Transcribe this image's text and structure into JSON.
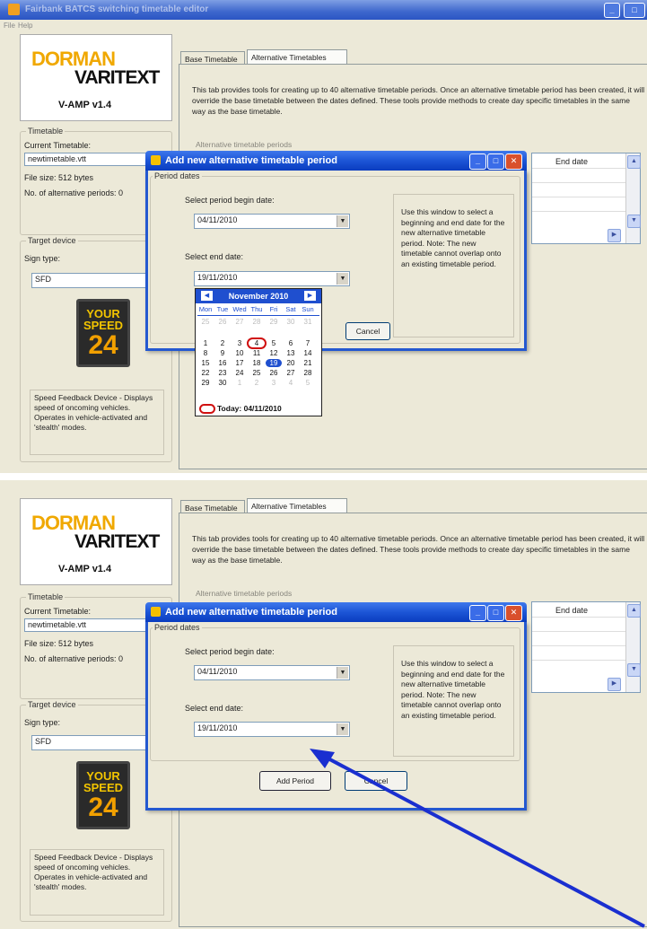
{
  "app": {
    "title": "Fairbank BATCS switching timetable editor",
    "menu": [
      "File",
      "Help"
    ]
  },
  "logo": {
    "brand_top": "DORMAN",
    "brand_bottom": "VARITEXT",
    "version": "V-AMP v1.4"
  },
  "timetable_panel": {
    "group_label": "Timetable",
    "current_label": "Current Timetable:",
    "current_value": "newtimetable.vtt",
    "filesize_label": "File size: 512 bytes",
    "alt_periods_label": "No. of alternative periods: 0"
  },
  "device_panel": {
    "group_label": "Target device",
    "sign_type_label": "Sign type:",
    "sign_type_value": "SFD",
    "sign": {
      "line1": "YOUR",
      "line2": "SPEED",
      "number": "24"
    },
    "description": "Speed Feedback Device - Displays speed of oncoming vehicles. Operates in vehicle-activated and 'stealth' modes."
  },
  "tabs": {
    "base": "Base Timetable",
    "alternative": "Alternative Timetables"
  },
  "tab_description": "This tab provides tools for creating up to 40 alternative timetable periods. Once an alternative timetable period has been created, it will override the base timetable between the dates defined. These tools provide methods to create day specific timetables in the same way as the base timetable.",
  "alt_periods_group_label": "Alternative timetable periods",
  "grid": {
    "end_date_header": "End date"
  },
  "dialog": {
    "title": "Add new alternative timetable period",
    "group_label": "Period dates",
    "begin_label": "Select period begin date:",
    "begin_value": "04/11/2010",
    "end_label": "Select end date:",
    "end_value": "19/11/2010",
    "help_text": "Use this window to select a beginning and end date for the new alternative timetable period. Note: The new timetable cannot overlap onto an existing timetable period.",
    "add_button": "Add Period",
    "cancel_button": "Cancel"
  },
  "calendar": {
    "month": "November 2010",
    "dow": [
      "Mon",
      "Tue",
      "Wed",
      "Thu",
      "Fri",
      "Sat",
      "Sun"
    ],
    "weeks": [
      [
        "25",
        "26",
        "27",
        "28",
        "29",
        "30",
        "31"
      ],
      [
        "1",
        "2",
        "3",
        "4",
        "5",
        "6",
        "7"
      ],
      [
        "8",
        "9",
        "10",
        "11",
        "12",
        "13",
        "14"
      ],
      [
        "15",
        "16",
        "17",
        "18",
        "19",
        "20",
        "21"
      ],
      [
        "22",
        "23",
        "24",
        "25",
        "26",
        "27",
        "28"
      ],
      [
        "29",
        "30",
        "1",
        "2",
        "3",
        "4",
        "5"
      ]
    ],
    "selected_day": "19",
    "today_day": "4",
    "today_label": "Today: 04/11/2010"
  },
  "colors": {
    "titlebar": "#2458d0",
    "arrow": "#1a2fd0",
    "today_ring": "#d01010",
    "sign_text": "#f2c400"
  },
  "icons": [
    "app-icon",
    "minimize-icon",
    "maximize-icon",
    "close-icon",
    "dropdown-arrow-icon",
    "scroll-up-icon",
    "scroll-down-icon",
    "scroll-right-icon",
    "calendar-prev-icon",
    "calendar-next-icon"
  ]
}
